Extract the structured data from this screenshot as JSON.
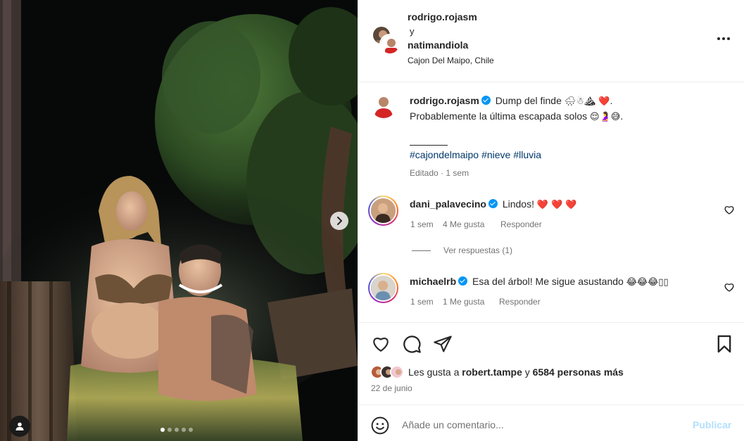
{
  "post": {
    "author": "rodrigo.rojasm",
    "joiner": "y",
    "coauthor": "natimandiola",
    "location": "Cajon Del Maipo, Chile",
    "more_icon": "more-horizontal-icon"
  },
  "caption": {
    "username": "rodrigo.rojasm",
    "line1": "Dump del finde",
    "line1_emojis": "🌧☃⛰",
    "line1_heart": "❤️",
    "line1_end": ".",
    "line2": "Probablemente la última escapada solos",
    "line2_emojis": "😌🤰😅",
    "line2_end": ".",
    "hashtags": [
      "#cajondelmaipo",
      "#nieve",
      "#lluvia"
    ],
    "edited": "Editado",
    "edited_sep": "·",
    "time": "1 sem"
  },
  "comments": [
    {
      "username": "dani_palavecino",
      "text": "Lindos!",
      "hearts": [
        "❤️",
        "❤️",
        "❤️"
      ],
      "time": "1 sem",
      "likes": "4 Me gusta",
      "reply": "Responder"
    },
    {
      "username": "michaelrb",
      "text": "Esa del árbol! Me sigue asustando",
      "emojis": "😂😂😂",
      "trailing": "▯▯",
      "time": "1 sem",
      "likes": "1 Me gusta",
      "reply": "Responder"
    }
  ],
  "view_replies": "Ver respuestas (1)",
  "likes": {
    "prefix": "Les gusta a",
    "user": "robert.tampe",
    "joiner": "y",
    "others": "6584 personas más"
  },
  "date": "22 de junio",
  "comment_box": {
    "placeholder": "Añade un comentario...",
    "post_label": "Publicar"
  },
  "carousel": {
    "total": 5,
    "current": 1
  },
  "colors": {
    "link": "#00376b",
    "verified": "#0095f6",
    "muted": "#737373",
    "post_disabled": "#b2dffc",
    "heart": "#e0201a"
  }
}
